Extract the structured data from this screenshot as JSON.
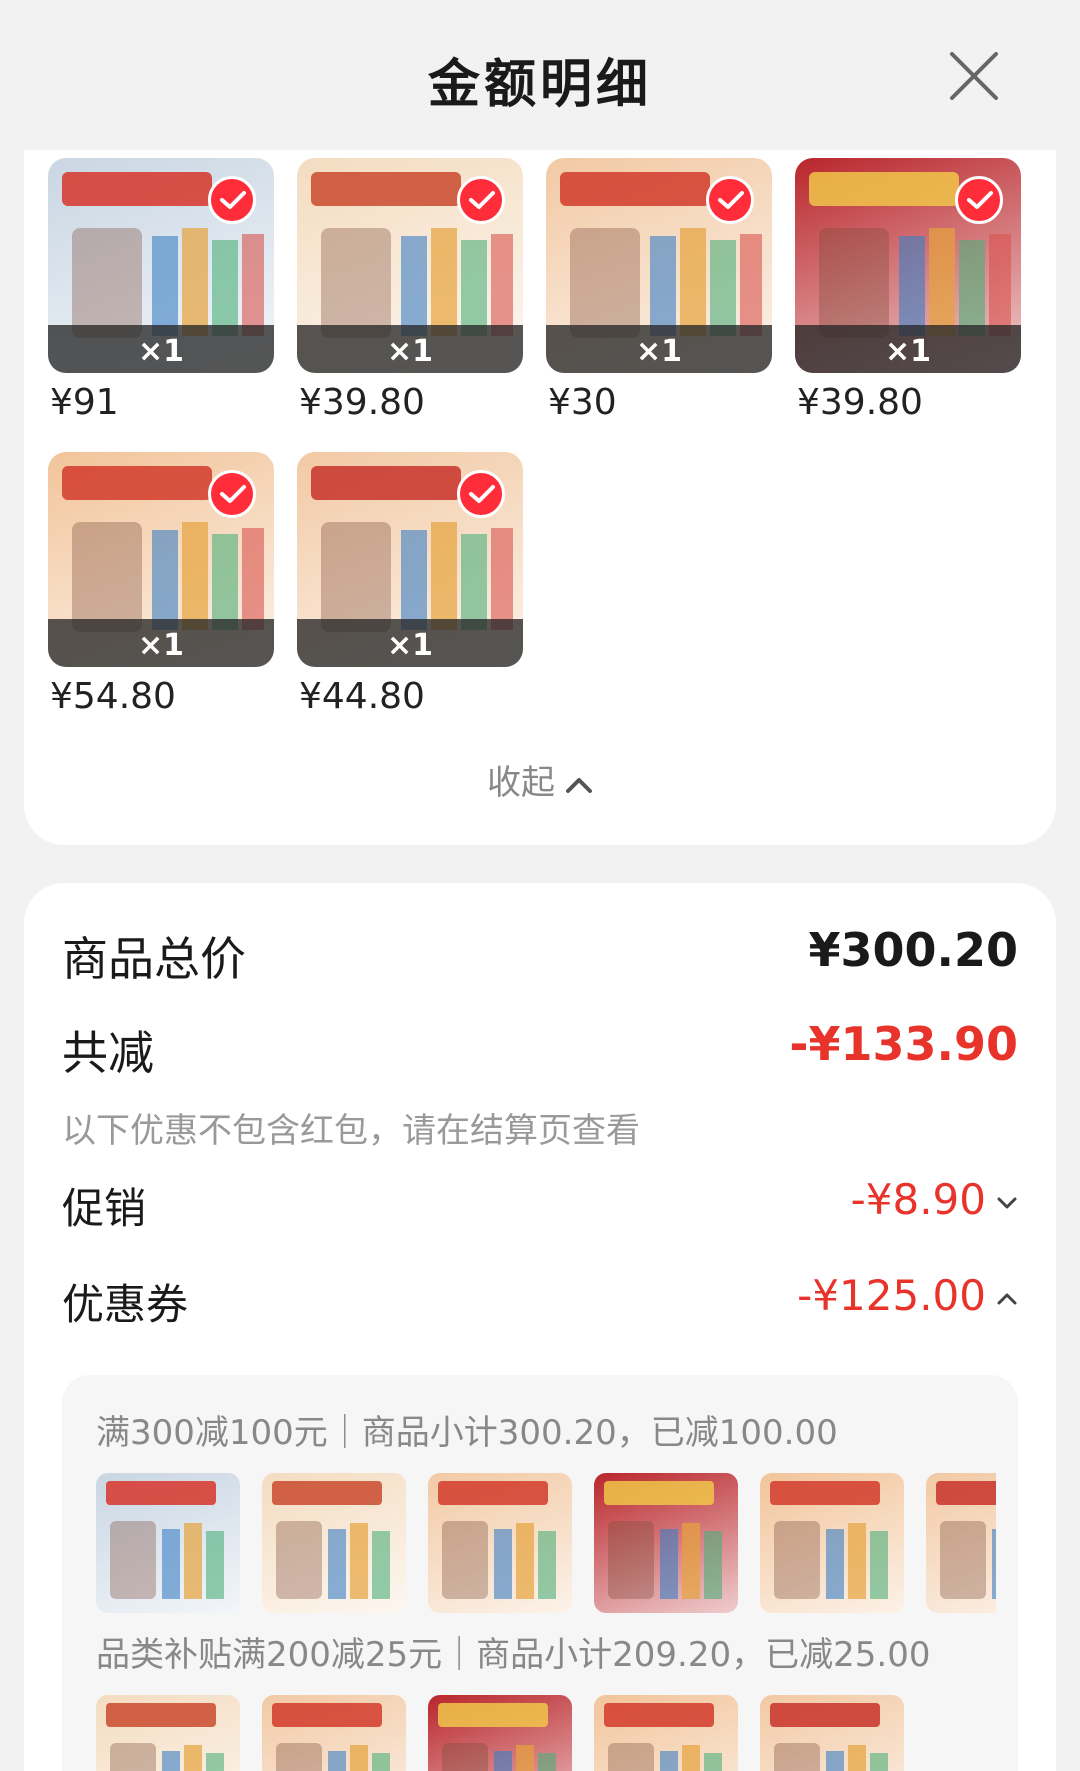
{
  "header": {
    "title": "金额明细",
    "close_icon": "close-icon"
  },
  "goods": [
    {
      "qty": "×1",
      "price": "¥91",
      "bg": "#c9d6e3",
      "accent": "#d7352a"
    },
    {
      "qty": "×1",
      "price": "¥39.80",
      "bg": "#f4dcc0",
      "accent": "#c94a2e"
    },
    {
      "qty": "×1",
      "price": "¥30",
      "bg": "#f2c9a4",
      "accent": "#d23b2c"
    },
    {
      "qty": "×1",
      "price": "¥39.80",
      "bg": "#b9262b",
      "accent": "#f0c64a"
    },
    {
      "qty": "×1",
      "price": "¥54.80",
      "bg": "#f2c49a",
      "accent": "#d23b2c"
    },
    {
      "qty": "×1",
      "price": "¥44.80",
      "bg": "#f2c9a4",
      "accent": "#c8322a"
    }
  ],
  "collapse_label": "收起",
  "summary": {
    "total_label": "商品总价",
    "total_value": "¥300.20",
    "reduce_label": "共减",
    "reduce_value": "-¥133.90",
    "note": "以下优惠不包含红包，请在结算页查看",
    "promo_label": "促销",
    "promo_value": "-¥8.90",
    "coupon_label": "优惠券",
    "coupon_value": "-¥125.00"
  },
  "coupons": [
    {
      "text": "满300减100元｜商品小计300.20，已减100.00"
    },
    {
      "text": "品类补贴满200减25元｜商品小计209.20，已减25.00"
    }
  ],
  "colors": {
    "accent_red": "#e8332b",
    "check_red": "#ff2d3a"
  }
}
